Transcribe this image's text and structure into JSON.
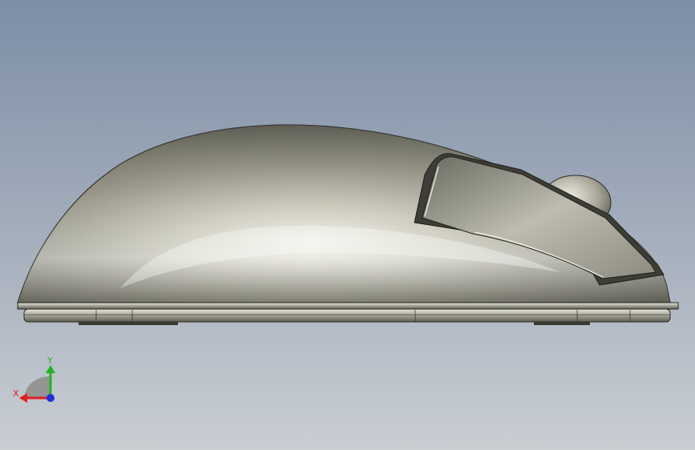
{
  "viewport": {
    "background_top": "#7d8fa6",
    "background_bottom": "#c6ccd2"
  },
  "model": {
    "name": "mouse-side-view",
    "body_color": "#b4b3a6",
    "edge_color": "#2a2a26"
  },
  "triad": {
    "x_label": "X",
    "y_label": "Y",
    "x_color": "#e02020",
    "y_color": "#1fb51f",
    "z_color": "#2030e0"
  }
}
